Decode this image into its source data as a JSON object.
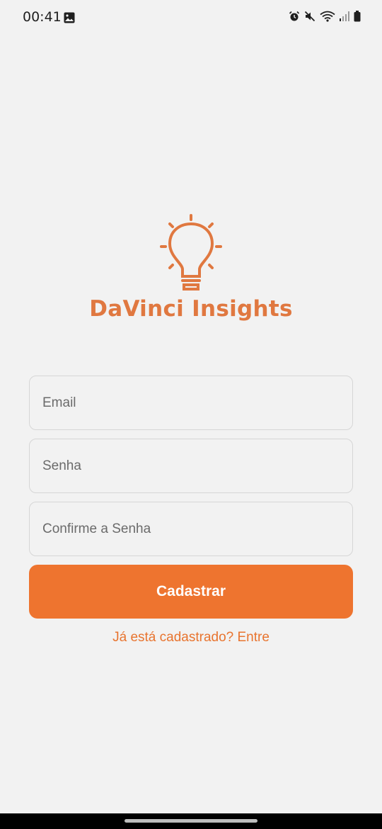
{
  "status_bar": {
    "time": "00:41",
    "icons": [
      "gallery-icon",
      "alarm-icon",
      "mute-icon",
      "wifi-icon",
      "signal-icon",
      "battery-icon"
    ]
  },
  "logo": {
    "icon": "lightbulb-icon",
    "brand_name": "DaVinci Insights"
  },
  "form": {
    "email_placeholder": "Email",
    "password_placeholder": "Senha",
    "confirm_password_placeholder": "Confirme a Senha",
    "submit_label": "Cadastrar",
    "login_link": "Já está cadastrado? Entre"
  },
  "colors": {
    "accent": "#ee742f",
    "brand_text": "#e07840",
    "background": "#f2f2f2"
  }
}
